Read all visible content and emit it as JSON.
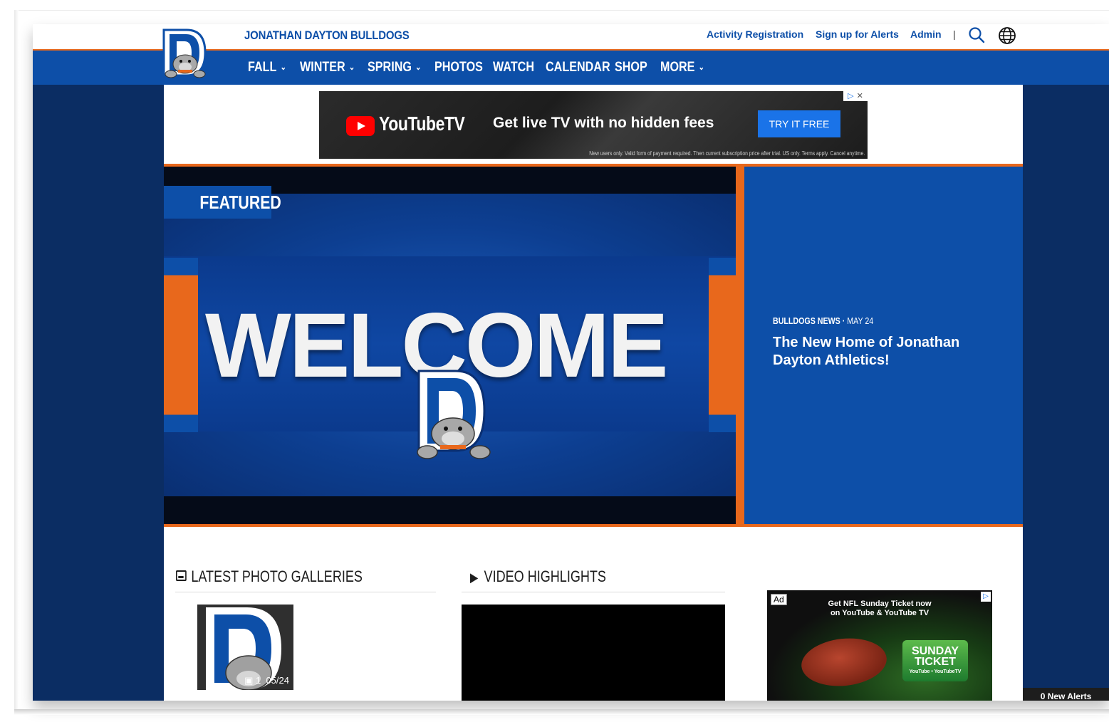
{
  "header": {
    "site_name": "JONATHAN DAYTON BULLDOGS",
    "links": [
      "Activity Registration",
      "Sign up for Alerts",
      "Admin"
    ],
    "separator": "|"
  },
  "nav": {
    "items": [
      {
        "label": "FALL",
        "dropdown": true
      },
      {
        "label": "WINTER",
        "dropdown": true
      },
      {
        "label": "SPRING",
        "dropdown": true
      },
      {
        "label": "PHOTOS",
        "dropdown": false
      },
      {
        "label": "WATCH",
        "dropdown": false
      },
      {
        "label": "CALENDAR",
        "dropdown": false
      },
      {
        "label": "SHOP",
        "dropdown": false
      },
      {
        "label": "MORE",
        "dropdown": true
      }
    ]
  },
  "banner_ad": {
    "brand": "YouTubeTV",
    "headline": "Get live TV with no hidden fees",
    "cta": "TRY IT FREE",
    "fine_print": "New users only. Valid form of payment required. Then current subscription price after trial. US only. Terms apply. Cancel anytime."
  },
  "featured": {
    "badge": "FEATURED",
    "image_text": "WELCOME",
    "category": "BULLDOGS NEWS",
    "date": "MAY 24",
    "headline": "The New Home of Jonathan Dayton Athletics!"
  },
  "sections": {
    "photos_title": "LATEST PHOTO GALLERIES",
    "video_title": "VIDEO HIGHLIGHTS"
  },
  "gallery": {
    "count": "1",
    "date": "05/24"
  },
  "side_ad": {
    "tag": "Ad",
    "line1": "Get NFL Sunday Ticket now",
    "line2": "on YouTube & YouTube TV",
    "ticket_line1": "SUNDAY",
    "ticket_line2": "TICKET",
    "ticket_sub": "YouTube • YouTubeTV"
  },
  "alerts": "0 New Alerts",
  "colors": {
    "brand_blue": "#0d4fa8",
    "brand_orange": "#e8681c",
    "page_navy": "#0b2d63"
  },
  "icons": [
    "search-icon",
    "globe-icon",
    "chevron-down-icon",
    "image-icon",
    "play-icon",
    "adchoices-icon",
    "close-icon"
  ]
}
